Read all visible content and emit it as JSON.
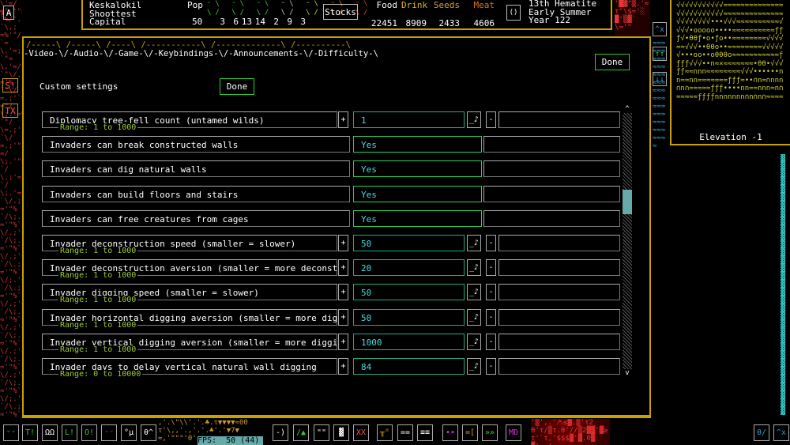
{
  "fortress": {
    "name": "Keskalokil",
    "translation": "Shoottest",
    "type": "Capital"
  },
  "pop": {
    "label": "Pop",
    "total": "50",
    "groups": [
      "3",
      "6",
      "13",
      "14",
      "2",
      "9",
      "3"
    ]
  },
  "stocks_button": "Stocks",
  "resources": [
    {
      "label": "Food",
      "value": "22451",
      "color": "#ffffff"
    },
    {
      "label": "Drink",
      "value": "8909",
      "color": "#e0b020"
    },
    {
      "label": "Seeds",
      "value": "2433",
      "color": "#d0a030"
    },
    {
      "label": "Meat",
      "value": "4606",
      "color": "#e07020"
    }
  ],
  "date": {
    "line1": "13th Hematite",
    "line2": "Early Summer",
    "line3": "Year 122"
  },
  "elevation": "Elevation -1",
  "tabs_top": "/-----\\ /-----\\ /----\\ /-----------\\ /-------------\\ /----------\\",
  "tabs": "-Video-\\/-Audio-\\/-Game-\\/-Keybindings-\\/-Announcements-\\/-Difficulty-\\",
  "done_label": "Done",
  "custom_settings": "Custom settings",
  "fps": "FPS:  50 (44)",
  "rows": [
    {
      "type": "num",
      "label": "Diplomacy tree-fell count (untamed wilds)",
      "range": "Range: 1 to 1000",
      "value": "1"
    },
    {
      "type": "bool",
      "label": "Invaders can break constructed walls",
      "value": "Yes"
    },
    {
      "type": "bool",
      "label": "Invaders can dig natural walls",
      "value": "Yes"
    },
    {
      "type": "bool",
      "label": "Invaders can build floors and stairs",
      "value": "Yes"
    },
    {
      "type": "bool",
      "label": "Invaders can free creatures from cages",
      "value": "Yes"
    },
    {
      "type": "num",
      "label": "Invader deconstruction speed (smaller = slower)",
      "range": "Range: 1 to 1000",
      "value": "50"
    },
    {
      "type": "num",
      "label": "Invader deconstruction aversion (smaller = more deconstruc",
      "range": "Range: 1 to 1000",
      "value": "20"
    },
    {
      "type": "num",
      "label": "Invader digging speed (smaller = slower)",
      "range": "Range: 1 to 1000",
      "value": "50"
    },
    {
      "type": "num",
      "label": "Invader horizontal digging aversion (smaller = more diggin",
      "range": "Range: 1 to 1000",
      "value": "50"
    },
    {
      "type": "num",
      "label": "Invader vertical digging aversion (smaller = more digging)",
      "range": "Range: 1 to 1000",
      "value": "1000"
    },
    {
      "type": "num",
      "label": "Invader days to delay vertical natural wall digging",
      "range": "Range: 0 to 10000",
      "value": "84"
    }
  ],
  "buttons": {
    "plus": "+",
    "minus": "-",
    "note": "_♪"
  },
  "left_buttons": [
    "A",
    "S!",
    "TX"
  ],
  "toolbar": [
    "ᵕᵕ",
    "T!",
    "ΩΩ",
    "L!",
    "O!",
    "ᵕᵕ",
    "°µ",
    "θ^",
    "-)",
    "/▲",
    "\"\"",
    "▓",
    "XX",
    "╥°",
    "==",
    "≡≡",
    "••",
    "=[",
    "»»",
    "MD",
    "θ/",
    "^x"
  ]
}
